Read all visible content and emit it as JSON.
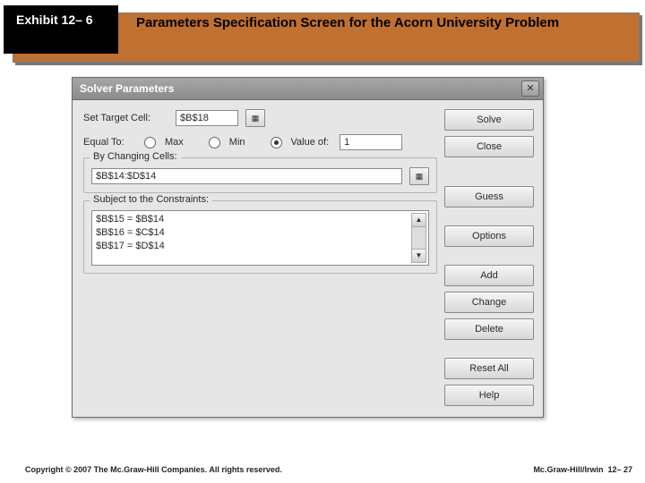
{
  "header": {
    "exhibit_label": "Exhibit 12– 6",
    "title": "Parameters Specification Screen for the Acorn University Problem"
  },
  "dialog": {
    "title": "Solver Parameters",
    "target_cell_label": "Set Target Cell:",
    "target_cell_value": "$B$18",
    "equal_to_label": "Equal To:",
    "opt_max": "Max",
    "opt_min": "Min",
    "opt_val": "Value of:",
    "value_of_value": "1",
    "changing_legend": "By Changing Cells:",
    "changing_value": "$B$14:$D$14",
    "constraints_legend": "Subject to the Constraints:",
    "constraints": [
      "$B$15 = $B$14",
      "$B$16 = $C$14",
      "$B$17 = $D$14"
    ],
    "buttons": {
      "solve": "Solve",
      "close": "Close",
      "guess": "Guess",
      "options": "Options",
      "add": "Add",
      "change": "Change",
      "delete": "Delete",
      "reset": "Reset All",
      "help": "Help"
    }
  },
  "footer": {
    "copyright": "Copyright © 2007 The Mc.Graw-Hill Companies. All rights reserved.",
    "brand": "Mc.Graw-Hill/Irwin",
    "page": "12– 27"
  }
}
